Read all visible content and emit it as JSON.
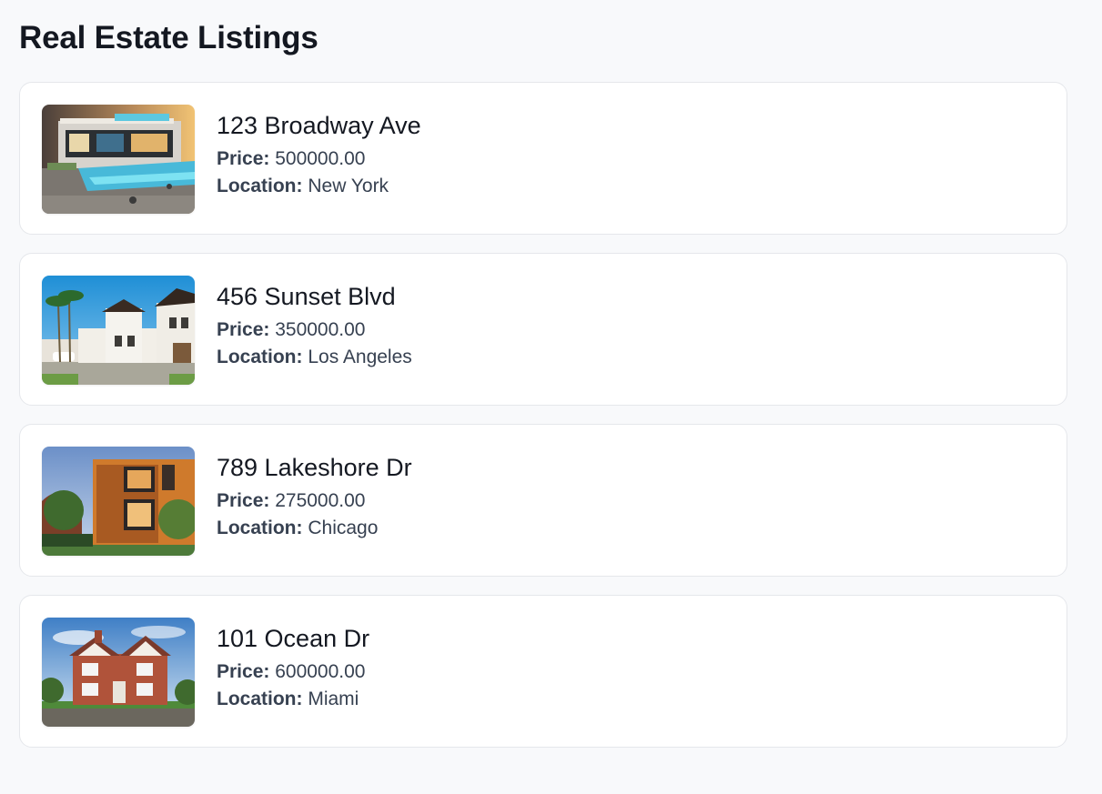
{
  "page": {
    "title": "Real Estate Listings"
  },
  "labels": {
    "price": "Price:",
    "location": "Location:"
  },
  "listings": [
    {
      "address": "123 Broadway Ave",
      "price": "500000.00",
      "location": "New York",
      "image": "luxury-modern-villa-with-pool-photo"
    },
    {
      "address": "456 Sunset Blvd",
      "price": "350000.00",
      "location": "Los Angeles",
      "image": "mediterranean-villa-with-palm-trees-photo"
    },
    {
      "address": "789 Lakeshore Dr",
      "price": "275000.00",
      "location": "Chicago",
      "image": "modern-wood-box-house-photo"
    },
    {
      "address": "101 Ocean Dr",
      "price": "600000.00",
      "location": "Miami",
      "image": "red-brick-victorian-house-photo"
    }
  ],
  "colors": {
    "background": "#f8f9fb",
    "card": "#ffffff",
    "card_border": "#e5e7eb",
    "title_text": "#141821",
    "body_text": "#374151"
  }
}
